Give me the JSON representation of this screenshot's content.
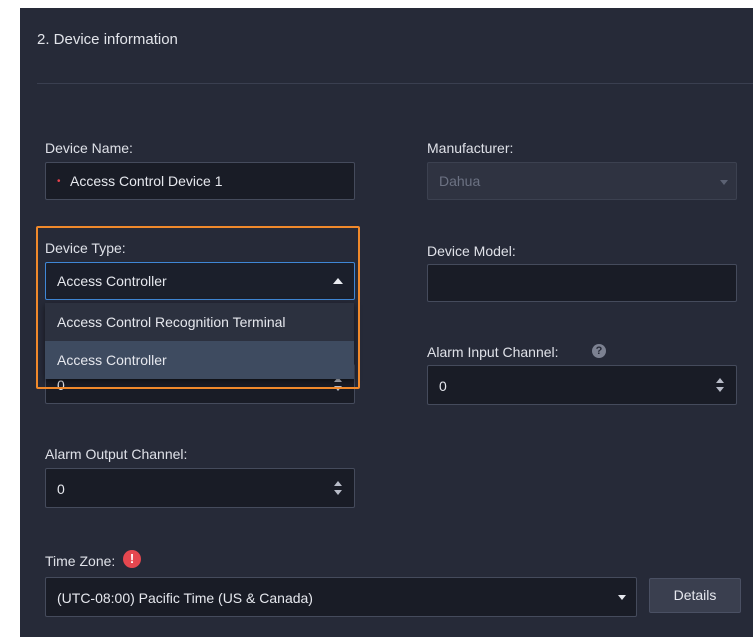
{
  "section": {
    "title": "2. Device information"
  },
  "device_name": {
    "label": "Device Name:",
    "value": "Access Control Device 1",
    "required": true
  },
  "manufacturer": {
    "label": "Manufacturer:",
    "value": "Dahua",
    "disabled": true
  },
  "device_type": {
    "label": "Device Type:",
    "value": "Access Controller",
    "options": [
      "Access Control Recognition Terminal",
      "Access Controller"
    ],
    "selected_option": "Access Controller",
    "highlight_color": "#f0892b"
  },
  "device_model": {
    "label": "Device Model:",
    "value": ""
  },
  "hidden_channel": {
    "value": "0"
  },
  "alarm_input_channel": {
    "label": "Alarm Input Channel:",
    "value": "0",
    "help_icon": "question-icon"
  },
  "alarm_output_channel": {
    "label": "Alarm Output Channel:",
    "value": "0"
  },
  "time_zone": {
    "label": "Time Zone:",
    "value": "(UTC-08:00) Pacific Time (US & Canada)",
    "alert_icon": "exclamation-icon",
    "details_label": "Details"
  },
  "colors": {
    "accent_blue": "#3f87d6",
    "required_red": "#e8414b",
    "panel_bg": "#262a38"
  }
}
